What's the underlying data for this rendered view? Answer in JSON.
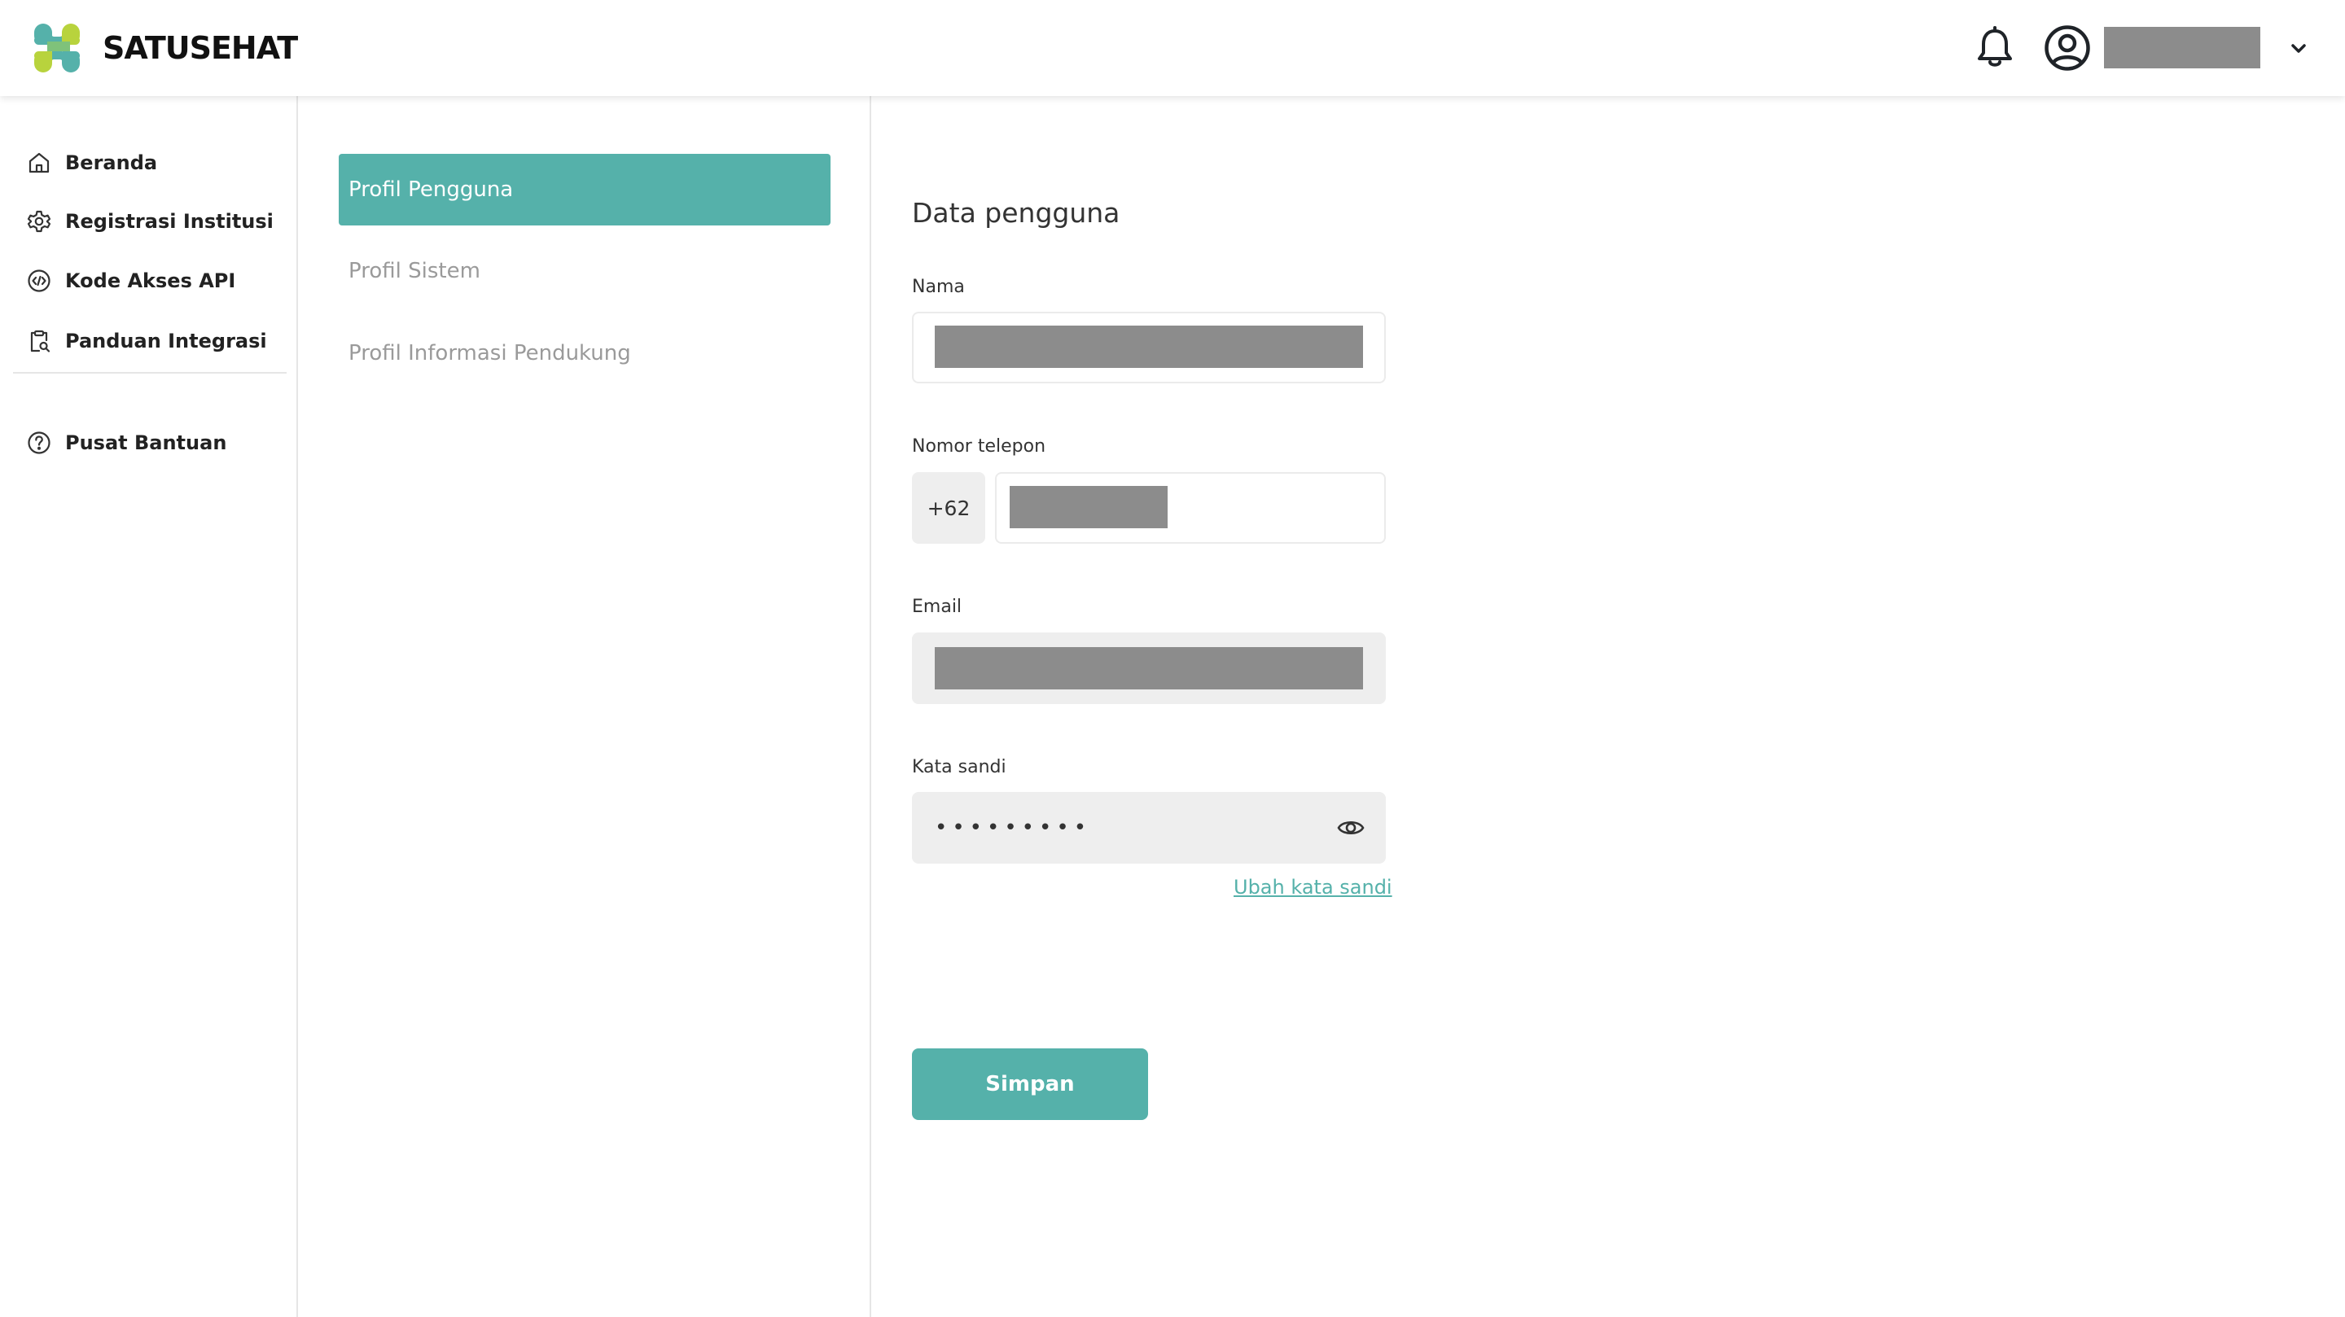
{
  "app": {
    "brand": "SATUSEHAT",
    "accent_color": "#55b1aa"
  },
  "header": {
    "notification_icon": "bell-icon",
    "account_icon": "user-circle-icon",
    "username": "",
    "dropdown_icon": "chevron-down-icon"
  },
  "sidebar": {
    "items": [
      {
        "label": "Beranda",
        "icon": "home-icon"
      },
      {
        "label": "Registrasi Institusi",
        "icon": "gear-icon"
      },
      {
        "label": "Kode Akses API",
        "icon": "code-icon"
      },
      {
        "label": "Panduan Integrasi",
        "icon": "clipboard-search-icon"
      }
    ],
    "help": {
      "label": "Pusat Bantuan",
      "icon": "question-circle-icon"
    }
  },
  "profile_menu": {
    "items": [
      {
        "label": "Profil Pengguna",
        "active": true
      },
      {
        "label": "Profil Sistem",
        "active": false
      },
      {
        "label": "Profil Informasi Pendukung",
        "active": false
      }
    ]
  },
  "form": {
    "title": "Data pengguna",
    "name": {
      "label": "Nama",
      "value": ""
    },
    "phone": {
      "label": "Nomor telepon",
      "prefix": "+62",
      "value": ""
    },
    "email": {
      "label": "Email",
      "value": ""
    },
    "password": {
      "label": "Kata sandi",
      "value": "•••••••••",
      "toggle_icon": "eye-icon"
    },
    "change_password_link": "Ubah kata sandi",
    "save_button": "Simpan"
  }
}
